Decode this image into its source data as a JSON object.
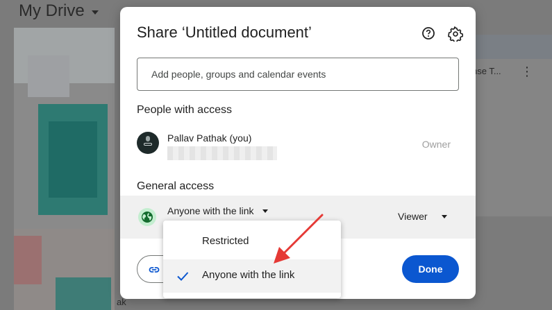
{
  "background": {
    "drive_title": "My Drive",
    "right_card_label": "nse T...",
    "bottom_text": "ak"
  },
  "dialog": {
    "title": "Share ‘Untitled document’",
    "help_icon": "help-circle-icon",
    "settings_icon": "gear-icon",
    "add_people_placeholder": "Add people, groups and calendar events",
    "people_section": "People with access",
    "people": [
      {
        "name": "Pallav Pathak (you)",
        "role": "Owner"
      }
    ],
    "general_access_section": "General access",
    "general_access_value": "Anyone with the link",
    "role_value": "Viewer",
    "done_label": "Done",
    "accent_color": "#0b57d0"
  },
  "access_menu": {
    "items": [
      {
        "label": "Restricted",
        "selected": false
      },
      {
        "label": "Anyone with the link",
        "selected": true
      }
    ]
  },
  "annotation_color": "#e53935"
}
